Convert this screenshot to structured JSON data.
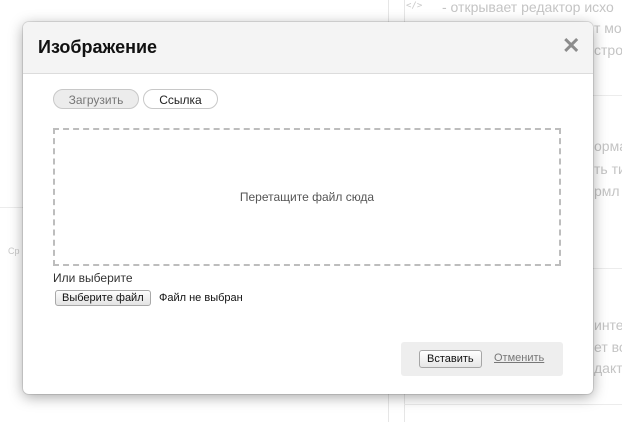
{
  "background": {
    "lines": [
      "- открывает редактор исхо",
      "т мо",
      "стро",
      "орма",
      "ть ти",
      "рмл",
      "инте",
      "ет во",
      "дакто"
    ],
    "code_icon": "</>",
    "side_label": "Ср"
  },
  "modal": {
    "title": "Изображение",
    "close_symbol": "✕",
    "tabs": {
      "upload": "Загрузить",
      "link": "Ссылка"
    },
    "dropzone_text": "Перетащите файл сюда",
    "or_choose": "Или выберите",
    "file_button": "Выберите файл",
    "file_status": "Файл не выбран",
    "insert_button": "Вставить",
    "cancel_link": "Отменить"
  },
  "colors": {
    "header_bg": "#f4f4f4",
    "active_tab_bg": "#ececec",
    "dashed_border": "#bdbdbd",
    "footer_bg": "#eeeeee"
  }
}
